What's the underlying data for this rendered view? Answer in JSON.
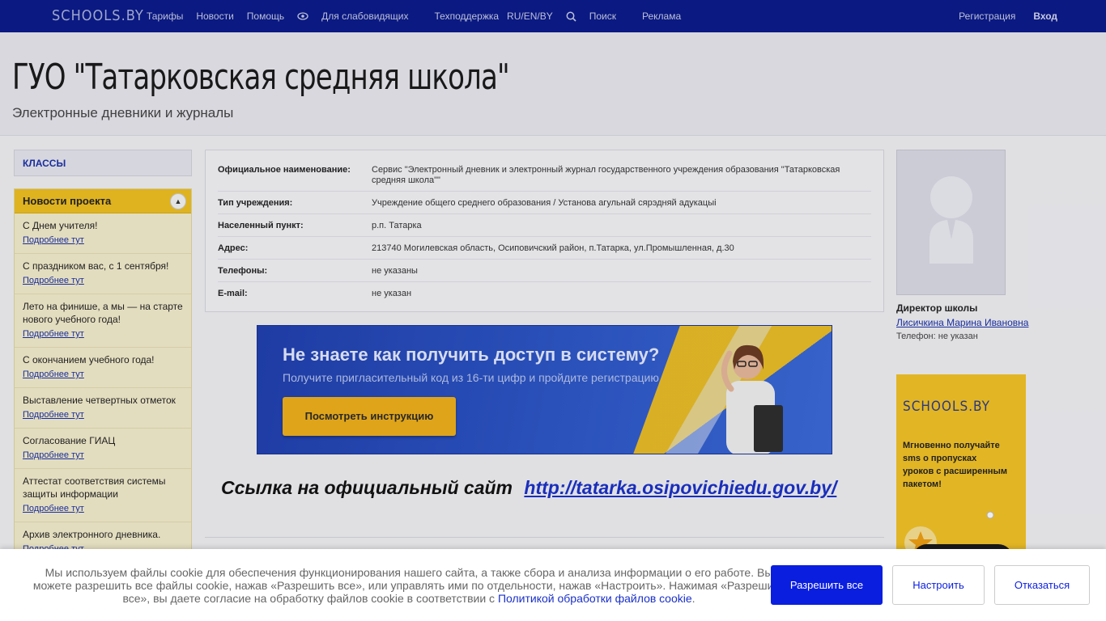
{
  "topbar": {
    "logo": "SCHOOLS.BY",
    "nav": [
      "Тарифы",
      "Новости",
      "Помощь",
      "Для слабовидящих",
      "Техподдержка",
      "RU/EN/BY",
      "Поиск",
      "Реклама"
    ],
    "register": "Регистрация",
    "login": "Вход"
  },
  "header": {
    "title": "ГУО \"Татарковская средняя школа\"",
    "subtitle": "Электронные дневники и журналы"
  },
  "sidebar": {
    "classes_label": "КЛАССЫ",
    "news_title": "Новости проекта",
    "more_label": "Подробнее тут",
    "news": [
      "С Днем учителя!",
      "С праздником вас, с 1 сентября!",
      "Лето на финише, а мы — на старте нового учебного года!",
      "С окончанием учебного года!",
      "Выставление четвертных отметок",
      "Согласование ГИАЦ",
      "Аттестат соответствия системы защиты информации",
      "Архив электронного дневника."
    ]
  },
  "info": {
    "rows": [
      {
        "k": "Официальное наименование:",
        "v": "Сервис \"Электронный дневник и электронный журнал государственного учреждения образования \"Татарковская средняя школа\"\""
      },
      {
        "k": "Тип учреждения:",
        "v": "Учреждение общего среднего образования / Установа агульнай сярэдняй адукацыі"
      },
      {
        "k": "Населенный пункт:",
        "v": "р.п. Татарка"
      },
      {
        "k": "Адрес:",
        "v": "213740 Могилевская область, Осиповичский район, п.Татарка, ул.Промышленная, д.30"
      },
      {
        "k": "Телефоны:",
        "v": "не указаны"
      },
      {
        "k": "E-mail:",
        "v": "не указан"
      }
    ]
  },
  "banner": {
    "title": "Не знаете как получить доступ в систему?",
    "desc": "Получите пригласительный код из 16-ти цифр и пройдите регистрацию",
    "button": "Посмотреть инструкцию"
  },
  "official": {
    "label": "Ссылка на  официальный сайт",
    "url": "http://tatarka.osipovichiedu.gov.by/"
  },
  "director": {
    "title": "Директор школы",
    "name": "Лисичкина Марина Ивановна",
    "phone": "Телефон: не указан"
  },
  "ad": {
    "logo": "SCHOOLS.BY",
    "text": "Мгновенно получайте sms о пропусках уроков с расширенным пакетом!"
  },
  "cookie": {
    "text": "Мы используем файлы cookie для обеспечения функционирования нашего сайта, а также сбора и анализа информации о его работе. Вы можете разрешить все файлы cookie, нажав «Разрешить все», или управлять ими по отдельности, нажав «Настроить». Нажимая «Разрешить все», вы даете согласие на обработку файлов cookie в соответствии с",
    "link": "Политикой обработки файлов cookie",
    "tail": ".",
    "allow": "Разрешить все",
    "configure": "Настроить",
    "deny": "Отказаться"
  }
}
